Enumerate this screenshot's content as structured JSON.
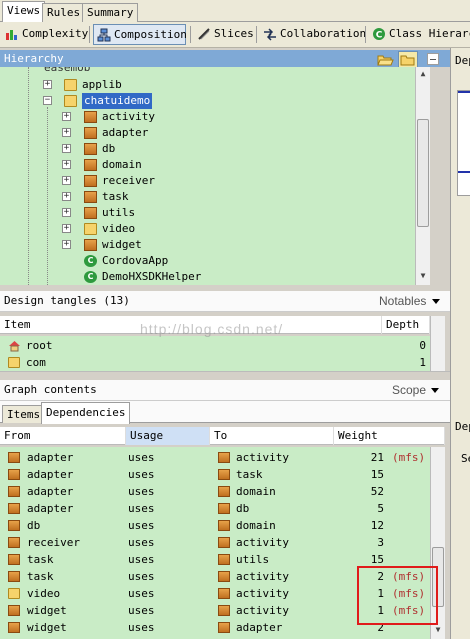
{
  "top_tabs": [
    "Views",
    "Rules",
    "Summary"
  ],
  "view_buttons": [
    "Complexity",
    "Composition",
    "Slices",
    "Collaboration",
    "Class Hierarc"
  ],
  "hierarchy": {
    "title": "Hierarchy",
    "partial_top": "easemob",
    "rows": [
      {
        "label": "applib",
        "icon": "folder"
      },
      {
        "label": "chatuidemo",
        "icon": "folder",
        "selected": true
      },
      {
        "label": "activity",
        "icon": "package"
      },
      {
        "label": "adapter",
        "icon": "package"
      },
      {
        "label": "db",
        "icon": "package"
      },
      {
        "label": "domain",
        "icon": "package"
      },
      {
        "label": "receiver",
        "icon": "package"
      },
      {
        "label": "task",
        "icon": "package"
      },
      {
        "label": "utils",
        "icon": "package"
      },
      {
        "label": "video",
        "icon": "folder"
      },
      {
        "label": "widget",
        "icon": "package"
      },
      {
        "label": "CordovaApp",
        "icon": "class"
      },
      {
        "label": "DemoHXSDKHelper",
        "icon": "class"
      }
    ]
  },
  "design_tangles": {
    "title": "Design tangles (13)",
    "dropdown": "Notables",
    "columns": [
      "Item",
      "Depth"
    ],
    "rows": [
      {
        "item": "root",
        "depth": "0"
      },
      {
        "item": "com",
        "depth": "1"
      }
    ]
  },
  "watermark": "http://blog.csdn.net/",
  "graph_contents": {
    "title": "Graph contents",
    "dropdown": "Scope",
    "tabs": [
      "Items",
      "Dependencies"
    ],
    "columns": [
      "From",
      "Usage",
      "To",
      "Weight"
    ],
    "rows": [
      {
        "from": "adapter",
        "from_icon": "package",
        "usage": "uses",
        "to": "activity",
        "weight": "21",
        "mfs": "(mfs)"
      },
      {
        "from": "adapter",
        "from_icon": "package",
        "usage": "uses",
        "to": "task",
        "weight": "15",
        "mfs": ""
      },
      {
        "from": "adapter",
        "from_icon": "package",
        "usage": "uses",
        "to": "domain",
        "weight": "52",
        "mfs": ""
      },
      {
        "from": "adapter",
        "from_icon": "package",
        "usage": "uses",
        "to": "db",
        "weight": "5",
        "mfs": ""
      },
      {
        "from": "db",
        "from_icon": "package",
        "usage": "uses",
        "to": "domain",
        "weight": "12",
        "mfs": ""
      },
      {
        "from": "receiver",
        "from_icon": "package",
        "usage": "uses",
        "to": "activity",
        "weight": "3",
        "mfs": ""
      },
      {
        "from": "task",
        "from_icon": "package",
        "usage": "uses",
        "to": "utils",
        "weight": "15",
        "mfs": ""
      },
      {
        "from": "task",
        "from_icon": "package",
        "usage": "uses",
        "to": "activity",
        "weight": "2",
        "mfs": "(mfs)"
      },
      {
        "from": "video",
        "from_icon": "folder",
        "usage": "uses",
        "to": "activity",
        "weight": "1",
        "mfs": "(mfs)"
      },
      {
        "from": "widget",
        "from_icon": "package",
        "usage": "uses",
        "to": "activity",
        "weight": "1",
        "mfs": "(mfs)"
      },
      {
        "from": "widget",
        "from_icon": "package",
        "usage": "uses",
        "to": "adapter",
        "weight": "2",
        "mfs": ""
      }
    ]
  },
  "right_panel": {
    "label_top": "Dep",
    "label_bottom": "Dep",
    "partial": "Se"
  }
}
